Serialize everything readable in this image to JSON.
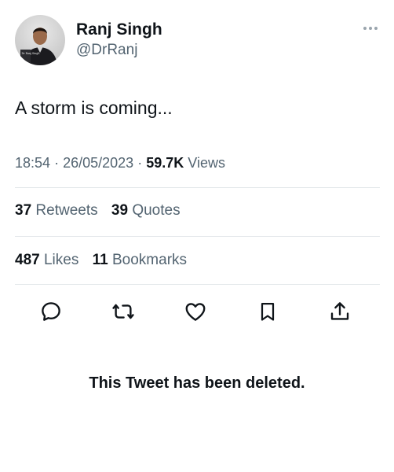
{
  "tweet": {
    "author": {
      "display_name": "Ranj Singh",
      "handle": "@DrRanj",
      "avatar_icon": "profile-photo",
      "avatar_book_text": "Dr Ranj Singh"
    },
    "text": "A storm is coming...",
    "time": "18:54",
    "separator": "·",
    "date": "26/05/2023",
    "views_count": "59.7K",
    "views_label": "Views",
    "retweets_count": "37",
    "retweets_label": "Retweets",
    "quotes_count": "39",
    "quotes_label": "Quotes",
    "likes_count": "487",
    "likes_label": "Likes",
    "bookmarks_count": "11",
    "bookmarks_label": "Bookmarks"
  },
  "actions": [
    "reply-icon",
    "retweet-icon",
    "like-icon",
    "bookmark-icon",
    "share-icon"
  ],
  "notice": {
    "deleted_text": "This Tweet has been deleted."
  },
  "colors": {
    "primary_text": "#0f1419",
    "secondary_text": "#536471",
    "divider": "#e3e7ea",
    "background": "#ffffff"
  }
}
